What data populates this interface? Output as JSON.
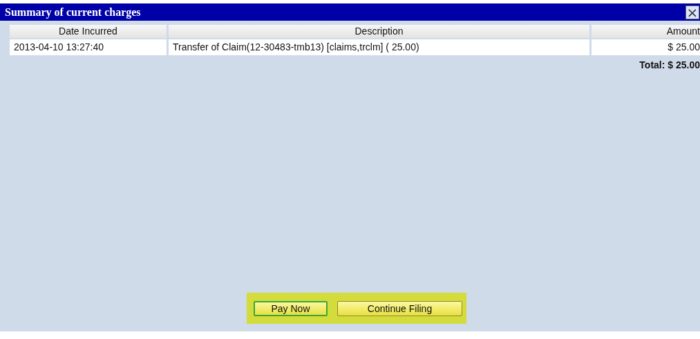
{
  "window": {
    "title": "Summary of current charges",
    "close": "×"
  },
  "table": {
    "columns": [
      "Date Incurred",
      "Description",
      "Amount"
    ],
    "rows": [
      {
        "cells": [
          "2013-04-10 13:27:40",
          "Transfer of Claim(12-30483-tmb13) [claims,trclm] ( 25.00)",
          "$ 25.00"
        ]
      }
    ],
    "total": "Total: $ 25.00"
  },
  "buttons": [
    {
      "label": "Pay Now",
      "selected": true
    },
    {
      "label": "Continue Filing",
      "selected": false
    }
  ]
}
